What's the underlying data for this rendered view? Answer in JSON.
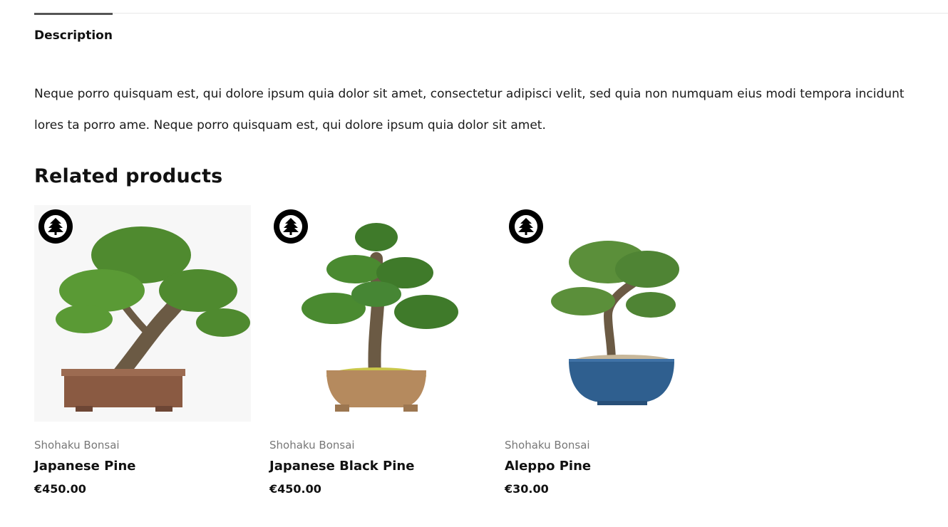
{
  "tabs": {
    "description_label": "Description"
  },
  "description": {
    "text": "Neque porro quisquam est, qui dolore ipsum quia dolor sit amet, consectetur adipisci velit, sed quia non numquam eius modi tempora incidunt lores ta porro ame. Neque porro quisquam est, qui dolore ipsum quia dolor sit amet."
  },
  "related": {
    "title": "Related products",
    "products": [
      {
        "vendor": "Shohaku Bonsai",
        "title": "Japanese Pine",
        "price": "€450.00",
        "badge_icon": "pine-crest-icon",
        "image": "bonsai-japanese-pine"
      },
      {
        "vendor": "Shohaku Bonsai",
        "title": "Japanese Black Pine",
        "price": "€450.00",
        "badge_icon": "pine-crest-icon",
        "image": "bonsai-japanese-black-pine"
      },
      {
        "vendor": "Shohaku Bonsai",
        "title": "Aleppo Pine",
        "price": "€30.00",
        "badge_icon": "pine-crest-icon",
        "image": "bonsai-aleppo-pine"
      }
    ]
  },
  "colors": {
    "foliage": "#4f8a2f",
    "trunk": "#6b5a44",
    "pot_brown": "#8a5a42",
    "pot_tan": "#b58a5e",
    "pot_blue": "#2f5f8f",
    "text_muted": "#777777"
  }
}
